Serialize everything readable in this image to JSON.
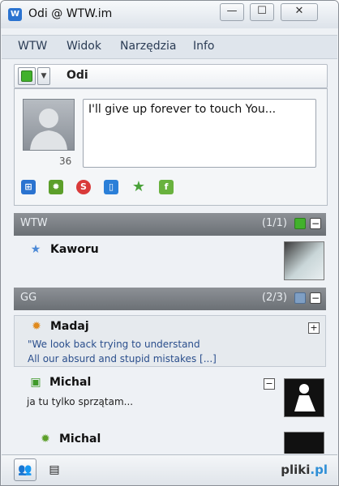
{
  "window": {
    "title": "Odi @ WTW.im",
    "app_icon": "W",
    "min_glyph": "—",
    "max_glyph": "☐",
    "close_glyph": "✕"
  },
  "menu": {
    "items": [
      "WTW",
      "Widok",
      "Narzędzia",
      "Info"
    ]
  },
  "status": {
    "nick": "Odi",
    "status_color": "#42b12c",
    "dropdown_glyph": "▼"
  },
  "profile": {
    "avatar_count": "36",
    "status_text": "I'll give up forever to touch You..."
  },
  "protocol_icons": [
    {
      "name": "network",
      "glyph": "⊞",
      "color": "#2a73d0"
    },
    {
      "name": "gadu-gadu",
      "glyph": "✹",
      "color": "#5c9f2a"
    },
    {
      "name": "skype",
      "glyph": "S",
      "color": "#d93a3a"
    },
    {
      "name": "notes",
      "glyph": "▯",
      "color": "#2b7fd8"
    },
    {
      "name": "favorite",
      "glyph": "★",
      "color": "#4aa23a"
    },
    {
      "name": "facebook",
      "glyph": "f",
      "color": "#69b23e"
    }
  ],
  "groups": [
    {
      "name": "WTW",
      "count": "(1/1)",
      "indicator_color": "#42b12c",
      "collapse": "−"
    },
    {
      "name": "GG",
      "count": "(2/3)",
      "indicator_color": "#7f9fc4",
      "collapse": "−"
    }
  ],
  "contacts": [
    {
      "name": "Kaworu",
      "status_icon": "★",
      "status_color": "#4a88d6"
    },
    {
      "name": "Madaj",
      "status_icon": "✹",
      "status_color": "#e08a1e",
      "toggle": "+",
      "desc_line1": "\"We look back trying to understand",
      "desc_line2": "All our absurd and stupid mistakes [...]"
    },
    {
      "name": "Michal",
      "status_icon": "▣",
      "status_color": "#3f9a2a",
      "toggle": "−",
      "desc_line1": "ja tu tylko sprzątam..."
    },
    {
      "name": "Michal",
      "status_icon": "✹",
      "status_color": "#5c9f2a"
    }
  ],
  "bottom": {
    "brand_prefix": "pliki",
    "brand_suffix": ".pl",
    "tab1_glyph": "👥",
    "tab2_glyph": "▤"
  }
}
